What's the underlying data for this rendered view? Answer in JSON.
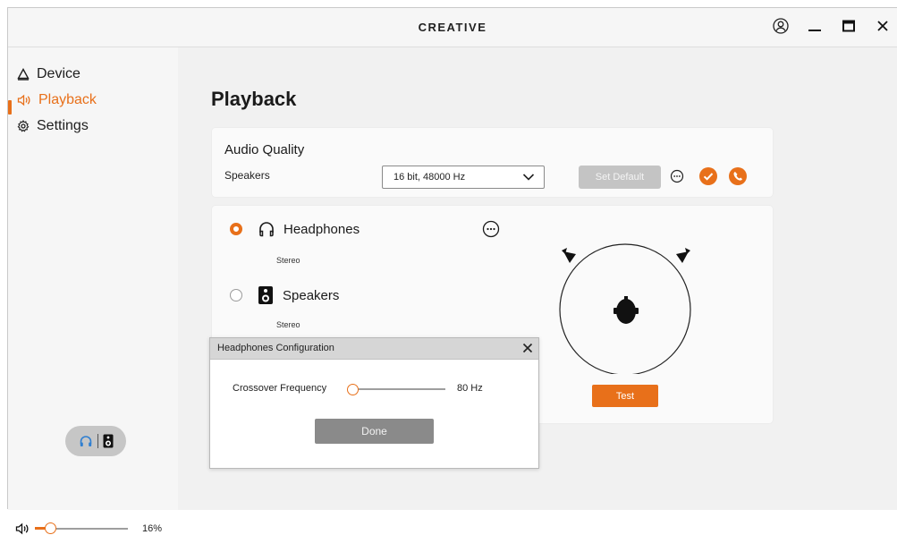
{
  "app": {
    "brand": "CREATIVE"
  },
  "window_controls": {
    "icons": [
      "account-icon",
      "minimize-icon",
      "maximize-icon",
      "close-icon"
    ]
  },
  "sidebar": {
    "items": [
      {
        "label": "Device",
        "icon": "device-icon",
        "active": false
      },
      {
        "label": "Playback",
        "icon": "speaker-wave-icon",
        "active": true
      },
      {
        "label": "Settings",
        "icon": "gear-icon",
        "active": false
      }
    ],
    "volume_percent": "16%",
    "volume_value": 16
  },
  "main": {
    "title": "Playback",
    "audio_quality": {
      "title": "Audio Quality",
      "device_label": "Speakers",
      "format_value": "16 bit, 48000 Hz",
      "set_default_label": "Set Default"
    },
    "devices": [
      {
        "name": "Headphones",
        "mode": "Stereo",
        "selected": true,
        "icon": "headphones-icon"
      },
      {
        "name": "Speakers",
        "mode": "Stereo",
        "selected": false,
        "icon": "speaker-icon"
      }
    ],
    "test_label": "Test"
  },
  "dialog": {
    "title": "Headphones Configuration",
    "crossover_label": "Crossover Frequency",
    "crossover_value": "80 Hz",
    "done_label": "Done"
  },
  "colors": {
    "accent": "#e8701a",
    "active_blue": "#2f7fd1",
    "disabled_button": "#c4c4c4",
    "done_button": "#8a8a8a"
  }
}
